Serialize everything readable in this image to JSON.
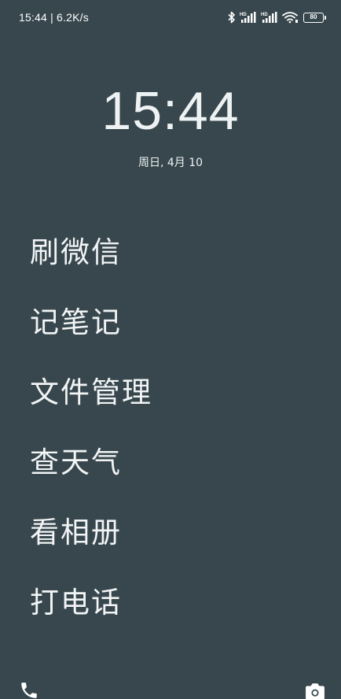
{
  "status_bar": {
    "time_speed": "15:44 | 6.2K/s",
    "battery_level": "80",
    "icons": [
      "bluetooth-icon",
      "signal-hd-icon",
      "signal-hd-icon",
      "wifi-icon",
      "battery-icon"
    ]
  },
  "lockscreen": {
    "clock": "15:44",
    "date": "周日, 4月 10"
  },
  "shortcuts": [
    {
      "label": "刷微信"
    },
    {
      "label": "记笔记"
    },
    {
      "label": "文件管理"
    },
    {
      "label": "查天气"
    },
    {
      "label": "看相册"
    },
    {
      "label": "打电话"
    }
  ],
  "bottom_bar": {
    "left_icon": "phone-icon",
    "right_icon": "camera-icon"
  },
  "colors": {
    "background": "#37474d",
    "text": "#ffffff"
  }
}
